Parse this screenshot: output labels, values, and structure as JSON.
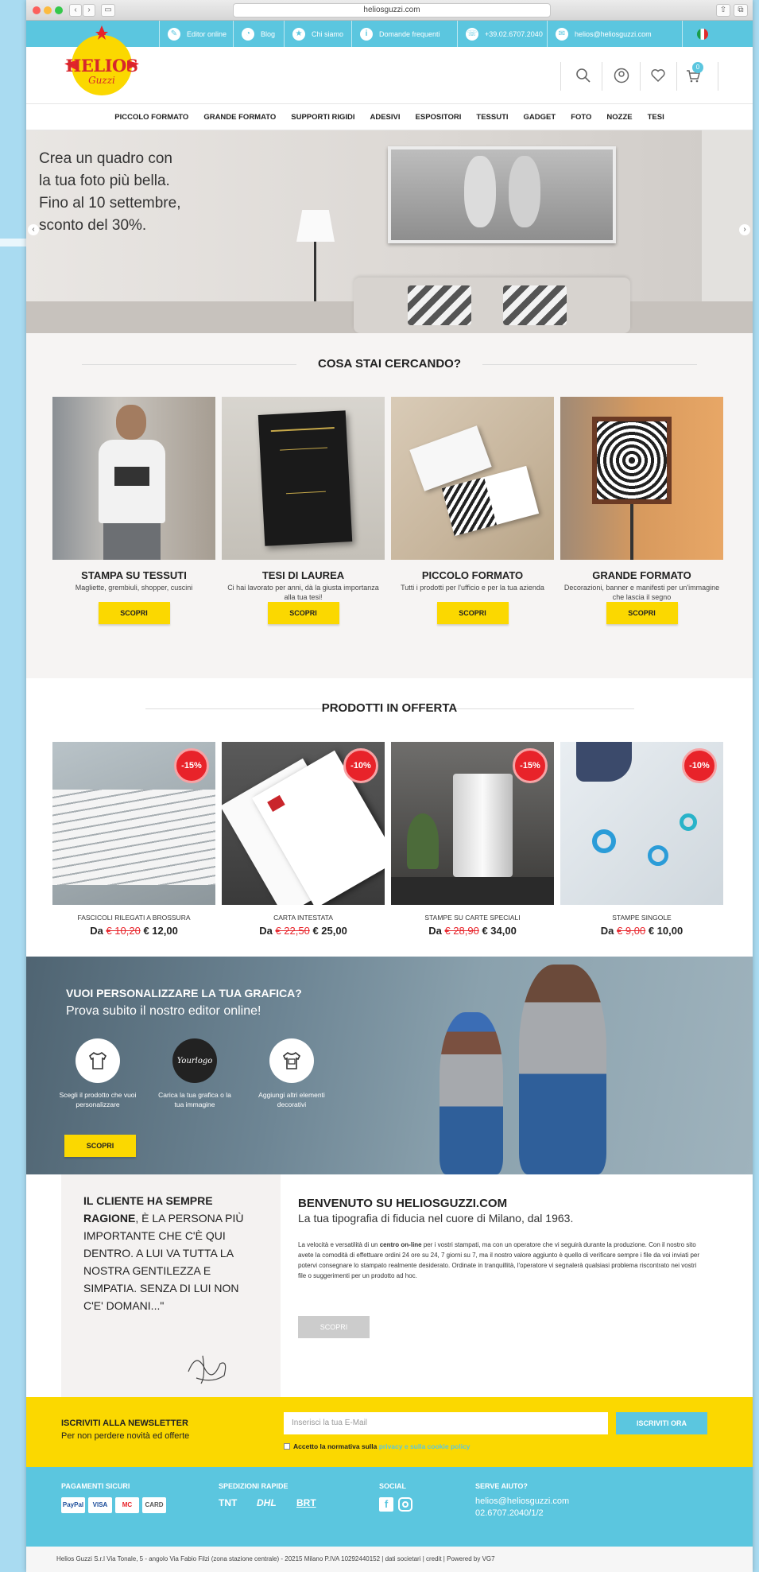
{
  "browser": {
    "url": "heliosguzzi.com"
  },
  "topbar": [
    {
      "label": "Editor online",
      "icon": "pencil-icon"
    },
    {
      "label": "Blog",
      "icon": "rss-icon"
    },
    {
      "label": "Chi siamo",
      "icon": "star-icon"
    },
    {
      "label": "Domande frequenti",
      "icon": "info-icon"
    },
    {
      "label": "+39.02.6707.2040",
      "icon": "phone-icon"
    },
    {
      "label": "helios@heliosguzzi.com",
      "icon": "mail-icon"
    }
  ],
  "logo": {
    "main": "HELIOS",
    "sub": "Guzzi"
  },
  "cart": {
    "count": "0"
  },
  "nav": [
    "PICCOLO FORMATO",
    "GRANDE FORMATO",
    "SUPPORTI RIGIDI",
    "ADESIVI",
    "ESPOSITORI",
    "TESSUTI",
    "GADGET",
    "FOTO",
    "NOZZE",
    "TESI"
  ],
  "hero": {
    "lines": [
      "Crea un quadro con",
      "la tua foto più bella.",
      "Fino al 10 settembre,",
      "sconto del 30%."
    ]
  },
  "categories": {
    "title": "COSA STAI CERCANDO?",
    "button": "SCOPRI",
    "items": [
      {
        "title": "STAMPA SU TESSUTI",
        "desc": "Magliette, grembiuli, shopper, cuscini"
      },
      {
        "title": "TESI DI LAUREA",
        "desc": "Ci hai lavorato per anni, dà la giusta importanza alla tua tesi!"
      },
      {
        "title": "PICCOLO FORMATO",
        "desc": "Tutti i prodotti per l'ufficio e per la tua azienda"
      },
      {
        "title": "GRANDE FORMATO",
        "desc": "Decorazioni, banner e manifesti per un'immagine che lascia il segno"
      }
    ]
  },
  "offers": {
    "title": "PRODOTTI IN OFFERTA",
    "prefix": "Da",
    "items": [
      {
        "name": "FASCICOLI RILEGATI A BROSSURA",
        "discount": "-15%",
        "old": "€ 10,20",
        "price": "€ 12,00"
      },
      {
        "name": "CARTA INTESTATA",
        "discount": "-10%",
        "old": "€ 22,50",
        "price": "€ 25,00"
      },
      {
        "name": "STAMPE SU CARTE SPECIALI",
        "discount": "-15%",
        "old": "€ 28,90",
        "price": "€ 34,00"
      },
      {
        "name": "STAMPE SINGOLE",
        "discount": "-10%",
        "old": "€ 9,00",
        "price": "€ 10,00"
      }
    ]
  },
  "editor": {
    "title": "VUOI PERSONALIZZARE LA TUA GRAFICA?",
    "subtitle": "Prova subito il nostro editor online!",
    "steps": [
      {
        "text": "Scegli il prodotto che vuoi personalizzare",
        "icon": "tshirt-icon"
      },
      {
        "text": "Carica la tua grafica o la tua immagine",
        "icon": "yourlogo-icon",
        "logo": "Yourlogo"
      },
      {
        "text": "Aggiungi altri elementi decorativi",
        "icon": "tshirt-print-icon"
      }
    ],
    "button": "SCOPRI"
  },
  "about": {
    "quote_strong1": "IL CLIENTE HA SEMPRE",
    "quote_strong2": "RAGIONE",
    "quote_rest": ", È LA PERSONA PIÙ IMPORTANTE CHE C'È QUI DENTRO. A LUI VA TUTTA LA NOSTRA GENTILEZZA E SIMPATIA. SENZA DI LUI NON C'E' DOMANI...\"",
    "title": "BENVENUTO SU HELIOSGUZZI.COM",
    "subtitle": "La tua tipografia di fiducia nel cuore di Milano, dal 1963.",
    "body1": "La velocità e versatilità di un ",
    "body_strong": "centro on-line",
    "body2": " per i vostri stampati, ma con un operatore che vi seguirà durante la produzione. Con il nostro sito avete la comodità di effettuare ordini 24 ore su 24, 7 giorni su 7, ma il nostro valore aggiunto è quello di verificare sempre i file da voi inviati per potervi consegnare lo stampato realmente desiderato. Ordinate in tranquillità, l'operatore vi segnalerà qualsiasi problema riscontrato nei vostri file o suggerimenti per un prodotto ad hoc.",
    "button": "SCOPRI"
  },
  "newsletter": {
    "title": "ISCRIVITI ALLA NEWSLETTER",
    "subtitle": "Per non perdere novità ed offerte",
    "placeholder": "Inserisci la tua E-Mail",
    "button": "ISCRIVITI ORA",
    "consent_prefix": "Accetto la normativa sulla ",
    "consent_link": "privacy e sulla cookie policy"
  },
  "footer": {
    "payments": {
      "title": "PAGAMENTI SICURI",
      "items": [
        "PayPal",
        "VISA",
        "MC",
        "CARD"
      ]
    },
    "shipping": {
      "title": "SPEDIZIONI RAPIDE",
      "items": [
        "TNT",
        "DHL",
        "BRT"
      ]
    },
    "social": {
      "title": "SOCIAL"
    },
    "help": {
      "title": "SERVE AIUTO?",
      "email": "helios@heliosguzzi.com",
      "phone": "02.6707.2040/1/2"
    },
    "legal": "Helios Guzzi S.r.l Via Tonale, 5 - angolo Via Fabio Filzi (zona stazione centrale) - 20215 Milano P.IVA 10292440152 | dati societari | credit | Powered by VG7"
  },
  "colors": {
    "accent": "#5bc6df",
    "yellow": "#fbd800",
    "red": "#e8232a"
  }
}
